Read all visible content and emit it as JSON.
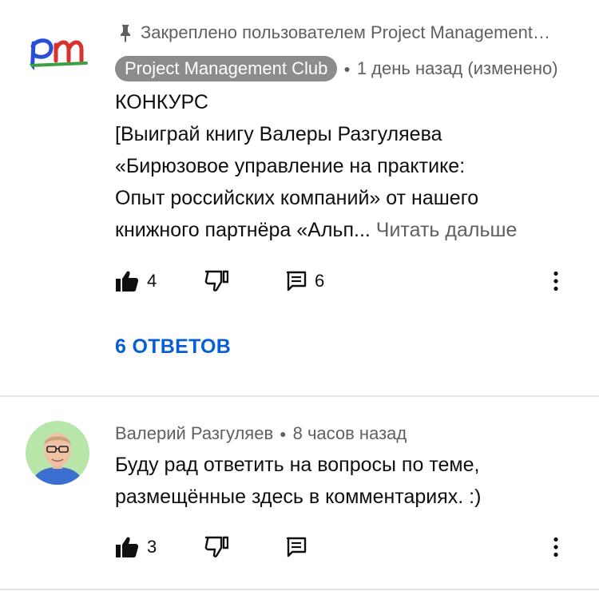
{
  "comments": [
    {
      "pinned_text": "Закреплено пользователем Project Management…",
      "author": "Project Management Club",
      "time": "1 день назад (изменено)",
      "avatar_text": "pm",
      "lines": [
        "КОНКУРС",
        "[Выиграй книгу Валеры Разгуляева",
        "«Бирюзовое управление на практике:",
        "Опыт российских компаний» от нашего",
        "книжного партнёра «Альп..."
      ],
      "read_more": "Читать дальше",
      "likes": "4",
      "replies_count": "6",
      "replies_link": "6 ОТВЕТОВ"
    },
    {
      "author": "Валерий Разгуляев",
      "time": "8 часов назад",
      "lines": [
        "Буду рад ответить на вопросы по теме,",
        "размещённые здесь в комментариях. :)"
      ],
      "likes": "3"
    }
  ],
  "icons": {
    "pin": "pin-icon",
    "like": "thumb-up-filled-icon",
    "dislike": "thumb-down-outline-icon",
    "reply": "comment-icon",
    "more": "more-vertical-icon"
  },
  "colors": {
    "link": "#065fd4",
    "secondary_text": "#606060",
    "author_chip": "#8c8c8c",
    "avatar_bg": "#b8e6a8",
    "divider": "#e5e5e5"
  }
}
